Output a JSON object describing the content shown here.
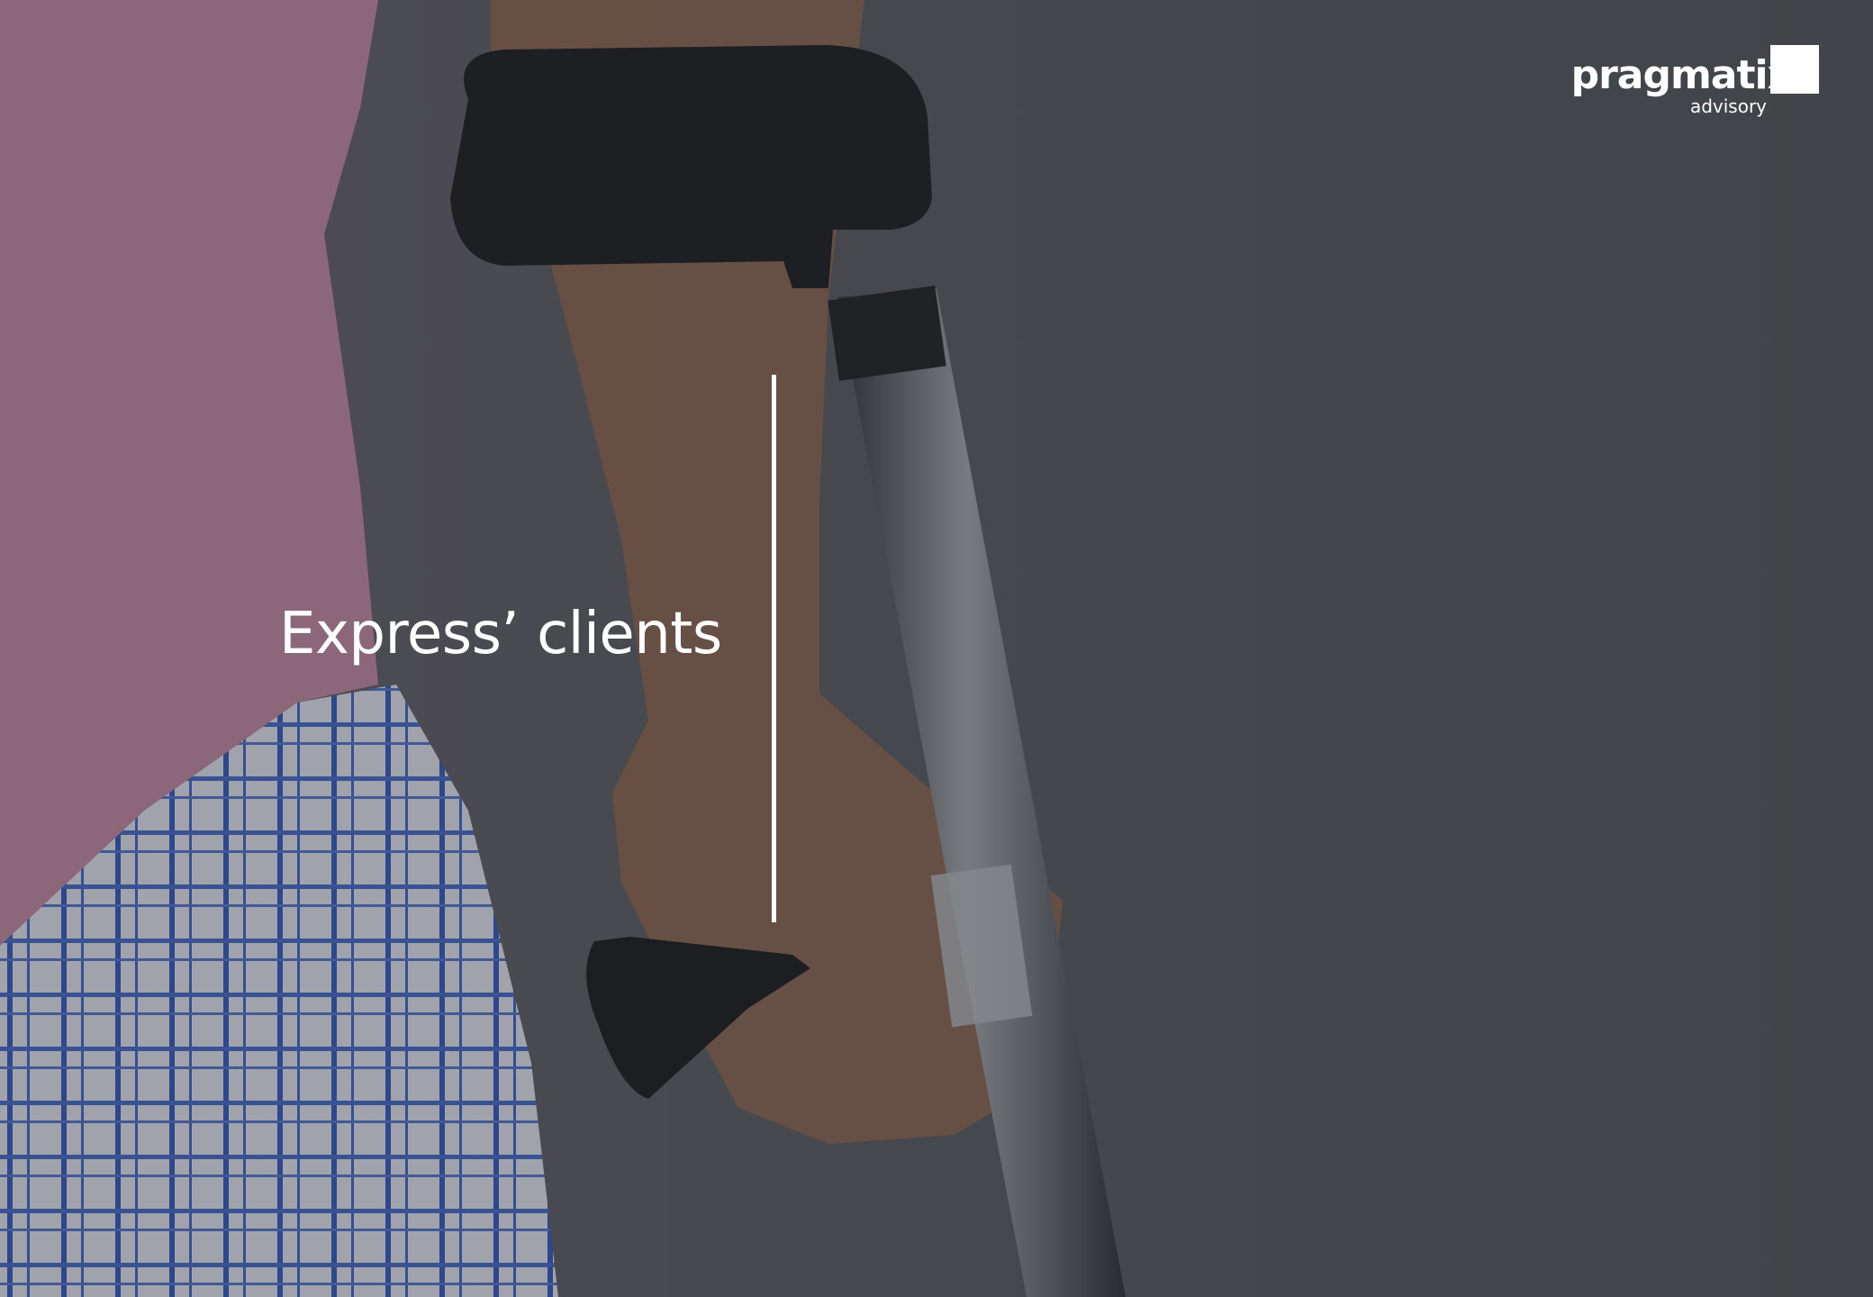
{
  "slide": {
    "title": "Express’ clients"
  },
  "logo": {
    "wordmark": "pragmatix",
    "subtitle": "advisory"
  },
  "colors": {
    "text": "#ffffff",
    "overlay": "#4a4d51",
    "shirt": "#b77f96",
    "shorts_check": "#2a4fa8"
  },
  "background_image": "person-holding-forearm-crutch"
}
